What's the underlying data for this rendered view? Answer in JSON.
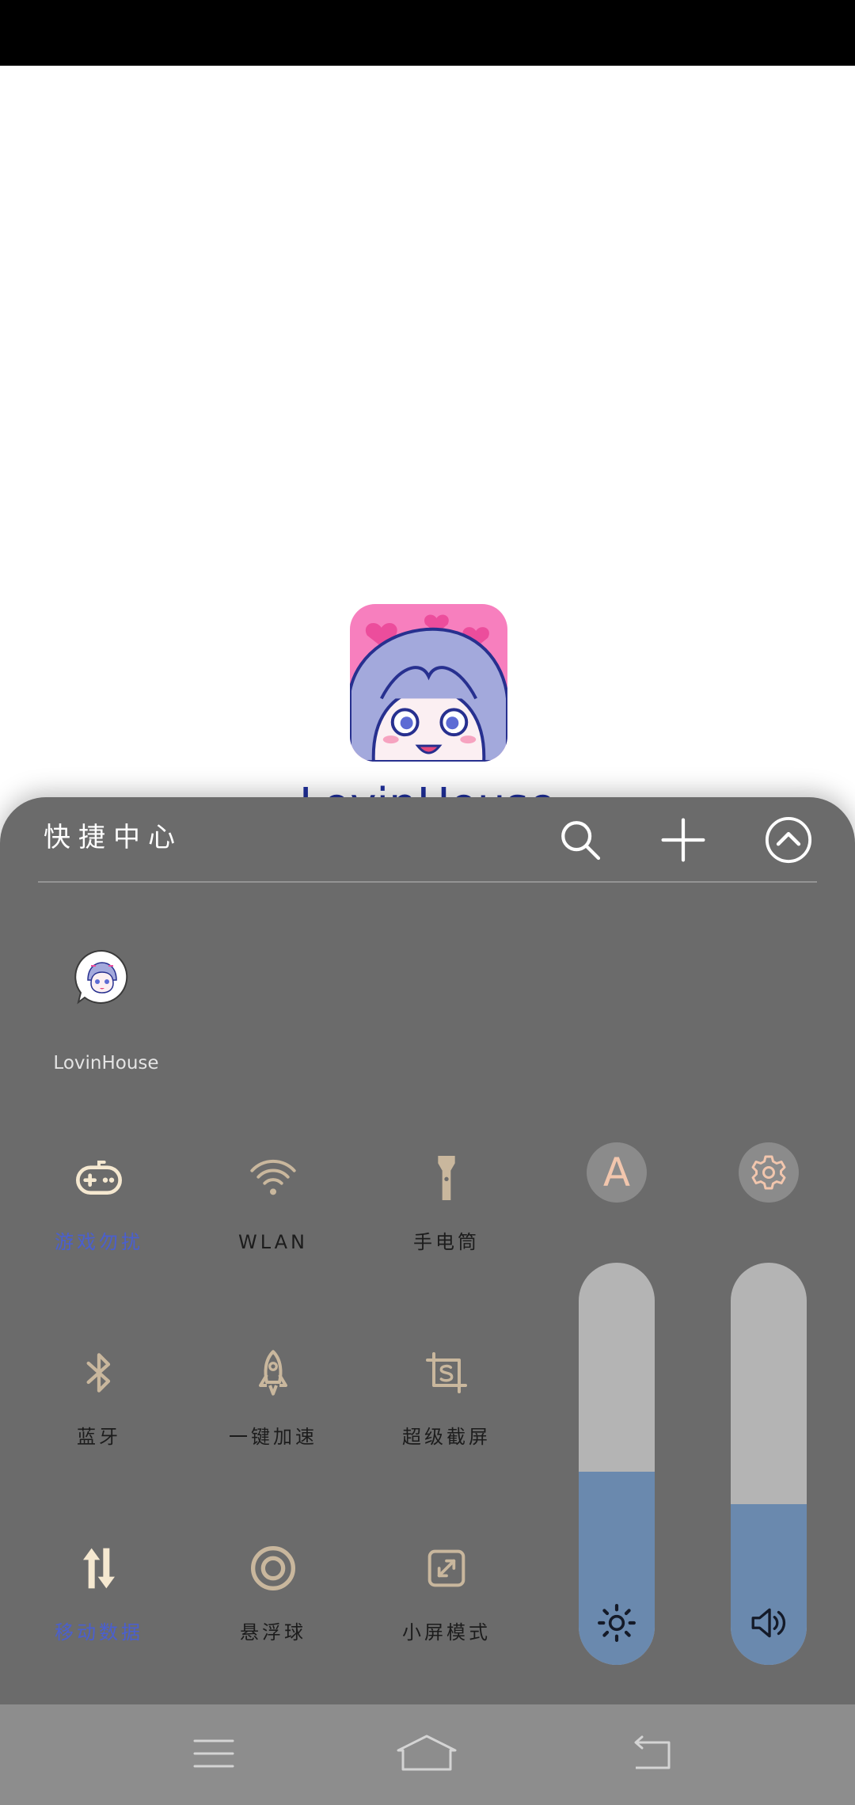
{
  "home": {
    "app_label": "LovinHouse",
    "app_icon": "lovinhouse-app-icon"
  },
  "panel": {
    "title": "快捷中心",
    "header_icons": [
      "search-icon",
      "plus-icon",
      "chevron-up-circle-icon"
    ],
    "shortcut_app": {
      "label": "LovinHouse",
      "icon": "lovinhouse-app-icon"
    },
    "toggles": [
      {
        "label": "游戏勿扰",
        "icon": "gamepad-icon",
        "active": true
      },
      {
        "label": "WLAN",
        "icon": "wifi-icon",
        "active": false
      },
      {
        "label": "手电筒",
        "icon": "flashlight-icon",
        "active": false
      },
      {
        "label": "蓝牙",
        "icon": "bluetooth-icon",
        "active": false
      },
      {
        "label": "一键加速",
        "icon": "rocket-icon",
        "active": false
      },
      {
        "label": "超级截屏",
        "icon": "super-screenshot-icon",
        "active": false
      },
      {
        "label": "移动数据",
        "icon": "mobile-data-icon",
        "active": true
      },
      {
        "label": "悬浮球",
        "icon": "floating-ball-icon",
        "active": false
      },
      {
        "label": "小屏模式",
        "icon": "small-screen-icon",
        "active": false
      }
    ],
    "auto_brightness": {
      "text": "A",
      "icon": "auto-brightness-icon"
    },
    "settings": {
      "icon": "gear-icon"
    },
    "brightness": {
      "level": 0.48,
      "icon": "sun-icon"
    },
    "volume": {
      "level": 0.4,
      "icon": "speaker-icon"
    }
  },
  "nav_bar": {
    "icons": [
      "menu-icon",
      "home-icon",
      "back-icon"
    ]
  },
  "colors": {
    "panel_bg": "#6b6b6b",
    "nav_bg": "#8d8d8d",
    "icon_tan": "#c9b79d",
    "icon_active": "#f5e8d0",
    "label_active": "#4a5fcf",
    "slider_track": "#b4b4b4",
    "slider_fill": "#6a89ae"
  }
}
